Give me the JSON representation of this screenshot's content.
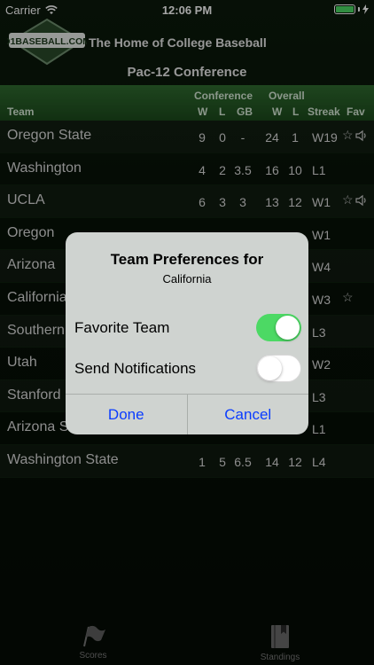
{
  "status_bar": {
    "carrier": "Carrier",
    "time": "12:06 PM",
    "battery_level": 1.0
  },
  "header": {
    "logo_text": "D1BASEBALL.COM",
    "app_title": "The Home of College Baseball",
    "conference_title": "Pac-12 Conference"
  },
  "table": {
    "group_headers": {
      "conference": "Conference",
      "overall": "Overall"
    },
    "columns": {
      "team": "Team",
      "conf_w": "W",
      "conf_l": "L",
      "gb": "GB",
      "overall_w": "W",
      "overall_l": "L",
      "streak": "Streak",
      "fav": "Fav"
    },
    "rows": [
      {
        "team": "Oregon State",
        "conf_w": "9",
        "conf_l": "0",
        "gb": "-",
        "overall_w": "24",
        "overall_l": "1",
        "streak": "W19",
        "favorite": true,
        "notify": true
      },
      {
        "team": "Washington",
        "conf_w": "4",
        "conf_l": "2",
        "gb": "3.5",
        "overall_w": "16",
        "overall_l": "10",
        "streak": "L1",
        "favorite": false,
        "notify": false
      },
      {
        "team": "UCLA",
        "conf_w": "6",
        "conf_l": "3",
        "gb": "3",
        "overall_w": "13",
        "overall_l": "12",
        "streak": "W1",
        "favorite": true,
        "notify": true
      },
      {
        "team": "Oregon",
        "conf_w": "",
        "conf_l": "",
        "gb": "",
        "overall_w": "",
        "overall_l": "",
        "streak": "W1",
        "favorite": false,
        "notify": false
      },
      {
        "team": "Arizona",
        "conf_w": "",
        "conf_l": "",
        "gb": "",
        "overall_w": "",
        "overall_l": "",
        "streak": "W4",
        "favorite": false,
        "notify": false
      },
      {
        "team": "California",
        "conf_w": "",
        "conf_l": "",
        "gb": "",
        "overall_w": "",
        "overall_l": "",
        "streak": "W3",
        "favorite": true,
        "notify": false
      },
      {
        "team": "Southern",
        "conf_w": "",
        "conf_l": "",
        "gb": "",
        "overall_w": "",
        "overall_l": "",
        "streak": "L3",
        "favorite": false,
        "notify": false
      },
      {
        "team": "Utah",
        "conf_w": "",
        "conf_l": "",
        "gb": "",
        "overall_w": "",
        "overall_l": "",
        "streak": "W2",
        "favorite": false,
        "notify": false
      },
      {
        "team": "Stanford",
        "conf_w": "",
        "conf_l": "",
        "gb": "",
        "overall_w": "",
        "overall_l": "",
        "streak": "L3",
        "favorite": false,
        "notify": false
      },
      {
        "team": "Arizona S",
        "conf_w": "",
        "conf_l": "",
        "gb": "",
        "overall_w": "",
        "overall_l": "",
        "streak": "L1",
        "favorite": false,
        "notify": false
      },
      {
        "team": "Washington State",
        "conf_w": "1",
        "conf_l": "5",
        "gb": "6.5",
        "overall_w": "14",
        "overall_l": "12",
        "streak": "L4",
        "favorite": false,
        "notify": false
      }
    ]
  },
  "dialog": {
    "title": "Team Preferences for",
    "subtitle": "California",
    "favorite_label": "Favorite Team",
    "favorite_on": true,
    "notifications_label": "Send Notifications",
    "notifications_on": false,
    "done_label": "Done",
    "cancel_label": "Cancel"
  },
  "tabbar": {
    "scores_label": "Scores",
    "standings_label": "Standings"
  },
  "colors": {
    "accent_green": "#4cd964",
    "button_blue": "#0a3cff",
    "header_band": "#2f6b2f"
  }
}
